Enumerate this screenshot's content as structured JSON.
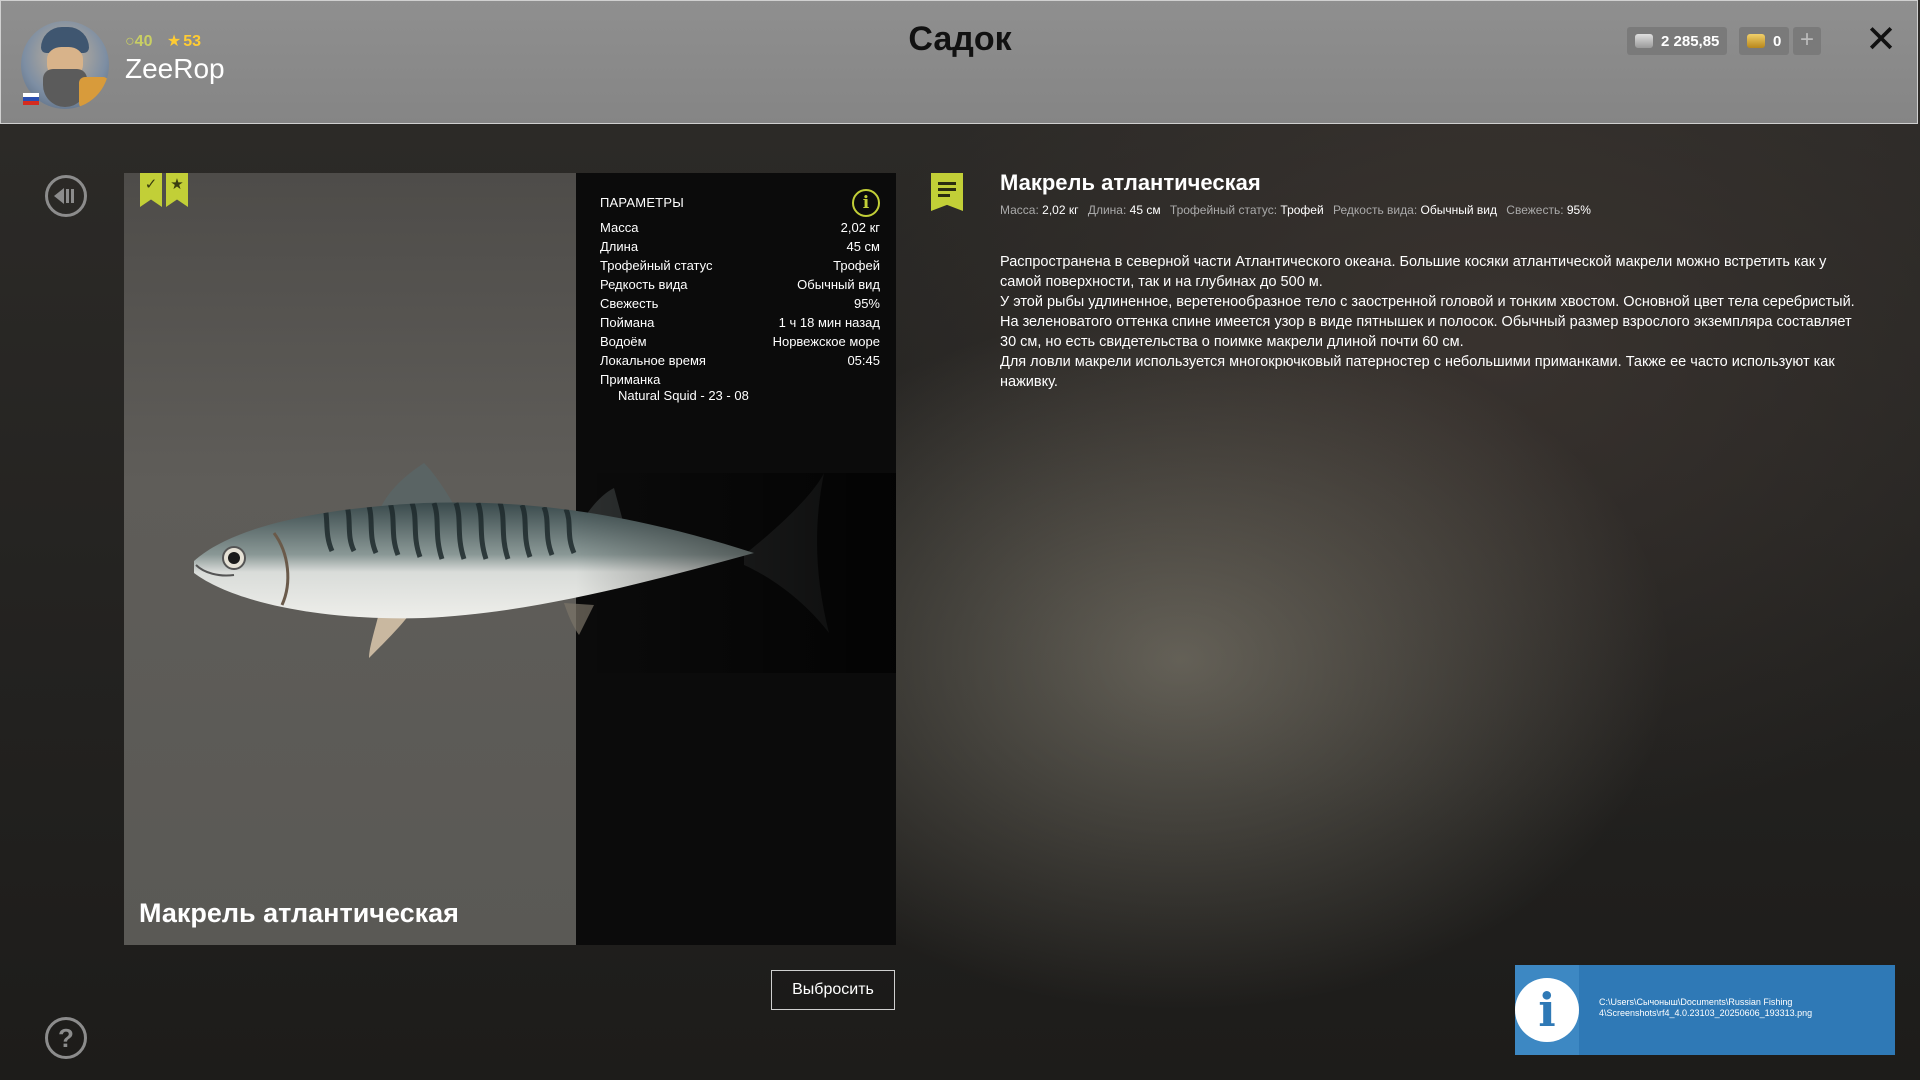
{
  "header": {
    "title": "Садок",
    "player": {
      "name": "ZeeRop",
      "level": "40",
      "stars": "53"
    },
    "silver": "2 285,85",
    "gold": "0"
  },
  "card": {
    "fish_name": "Макрель атлантическая",
    "params_title": "ПАРАМЕТРЫ",
    "params": [
      {
        "label": "Масса",
        "value": "2,02 кг"
      },
      {
        "label": "Длина",
        "value": "45 см"
      },
      {
        "label": "Трофейный статус",
        "value": "Трофей"
      },
      {
        "label": "Редкость вида",
        "value": "Обычный вид"
      },
      {
        "label": "Свежесть",
        "value": "95%"
      },
      {
        "label": "Поймана",
        "value": "1 ч 18 мин назад"
      },
      {
        "label": "Водоём",
        "value": "Норвежское море"
      },
      {
        "label": "Локальное время",
        "value": "05:45"
      }
    ],
    "bait_label": "Приманка",
    "bait_value": "Natural Squid - 23 - 08",
    "discard_label": "Выбросить"
  },
  "description": {
    "title": "Макрель атлантическая",
    "stats": [
      {
        "label": "Масса:",
        "value": "2,02 кг"
      },
      {
        "label": "Длина:",
        "value": "45 см"
      },
      {
        "label": "Трофейный статус:",
        "value": "Трофей"
      },
      {
        "label": "Редкость вида:",
        "value": "Обычный вид"
      },
      {
        "label": "Свежесть:",
        "value": "95%"
      }
    ],
    "paragraphs": [
      "Распространена в северной части Атлантического океана. Большие косяки атлантической макрели можно встретить как у самой поверхности, так и на глубинах до 500 м.",
      "У этой рыбы удлиненное, веретенообразное тело с заостренной головой и тонким хвостом. Основной цвет тела серебристый. На зеленоватого оттенка спине имеется узор в виде пятнышек и полосок. Обычный размер взрослого экземпляра составляет 30 см, но есть свидетельства о поимке макрели длиной почти 60 см.",
      "Для ловли макрели используется многокрючковый патерностер с небольшими приманками. Также ее часто используют как наживку."
    ]
  },
  "toast": {
    "path": "C:\\Users\\Сычоныш\\Documents\\Russian Fishing 4\\Screenshots\\rf4_4.0.23103_20250606_193313.png"
  },
  "icons": [
    "back-icon",
    "help-icon",
    "close-icon",
    "plus-icon",
    "info-icon",
    "note-icon",
    "trophy-badge-icon",
    "star-badge-icon"
  ],
  "colors": {
    "accent": "#c2cf37",
    "header_bg": "#8a8a8a",
    "toast_bg": "#2f79b6"
  }
}
